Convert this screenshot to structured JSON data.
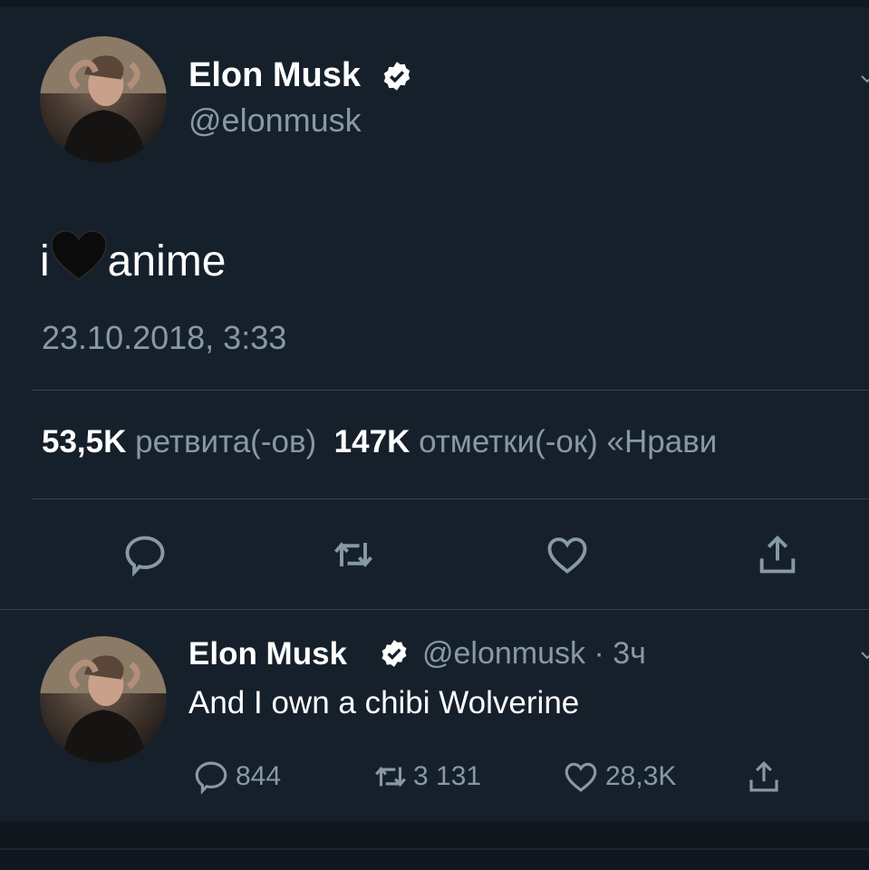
{
  "tweet": {
    "author_name": "Elon Musk",
    "author_handle": "@elonmusk",
    "text_before": "i",
    "text_after": "anime",
    "timestamp": "23.10.2018, 3:33",
    "retweets_count": "53,5K",
    "retweets_label": "ретвита(-ов)",
    "likes_count": "147K",
    "likes_label": "отметки(-ок) «Нрави",
    "icons": [
      "reply-icon",
      "retweet-icon",
      "like-icon",
      "share-icon"
    ]
  },
  "reply": {
    "author_name": "Elon Musk",
    "author_handle": "@elonmusk",
    "separator": "·",
    "time_ago": "3ч",
    "text": "And I own a chibi Wolverine",
    "reply_count": "844",
    "retweet_count": "3 131",
    "like_count": "28,3K"
  },
  "colors": {
    "background": "#15202b",
    "secondary_text": "#8899a6",
    "divider": "#38444d"
  }
}
